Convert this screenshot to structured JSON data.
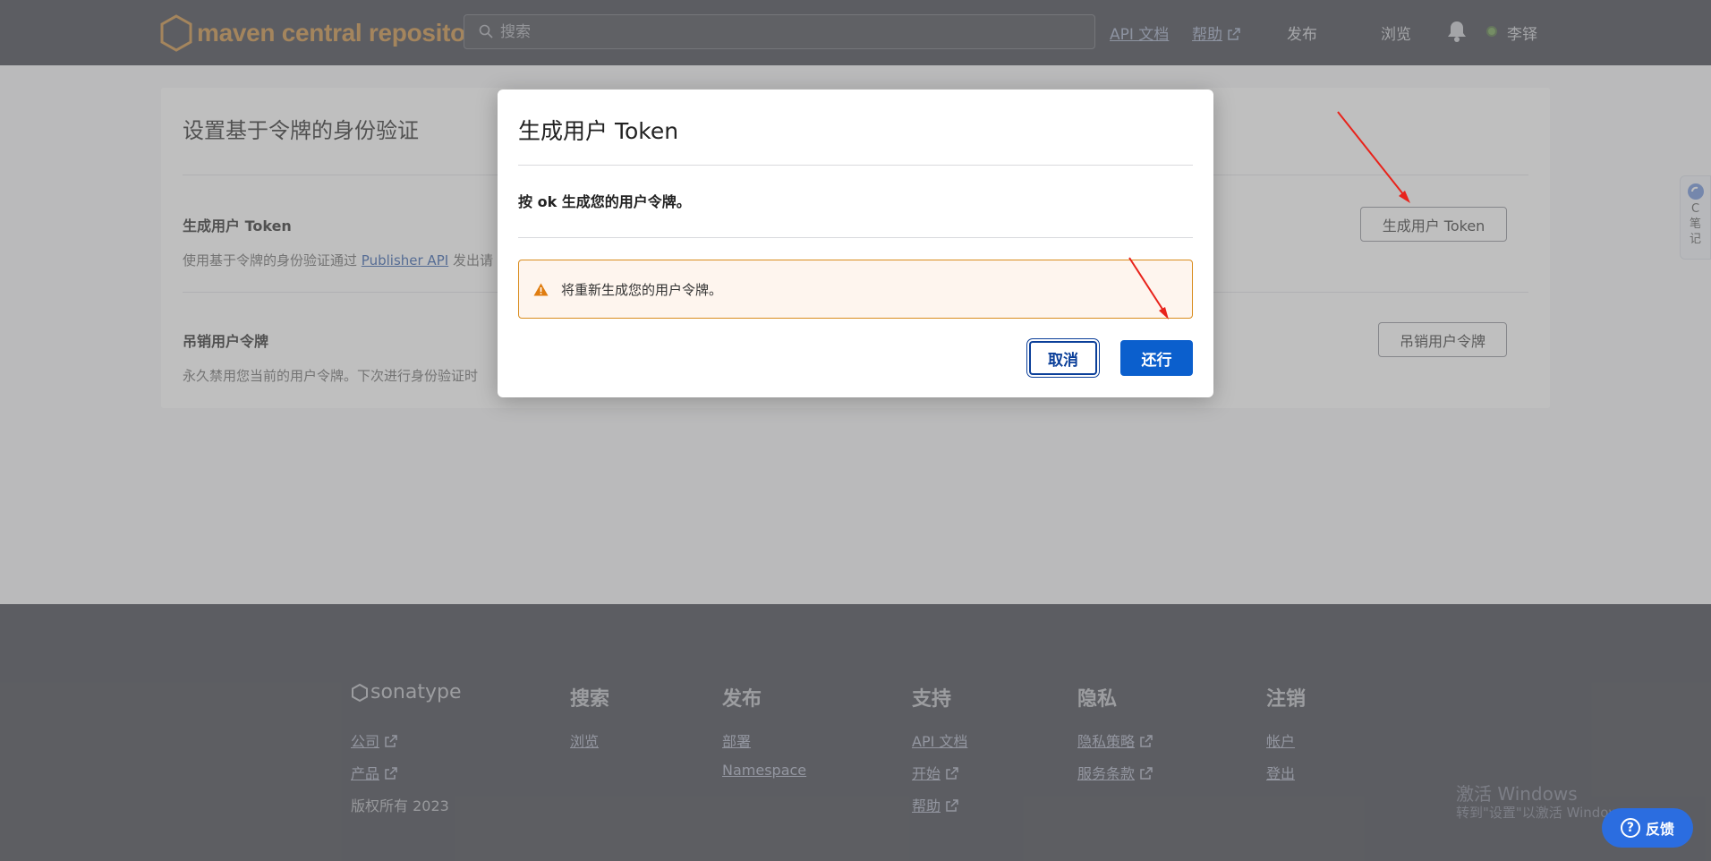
{
  "header": {
    "logo_text": "maven central repository",
    "search_placeholder": "搜索",
    "nav": {
      "api_docs": "API 文档",
      "help": "帮助",
      "publish": "发布",
      "browse": "浏览"
    },
    "user_name": "李铎"
  },
  "page": {
    "title": "设置基于令牌的身份验证",
    "generate": {
      "title": "生成用户 Token",
      "desc_prefix": "使用基于令牌的身份验证通过",
      "desc_link": "Publisher API",
      "desc_suffix": "发出请",
      "button": "生成用户 Token"
    },
    "revoke": {
      "title": "吊销用户令牌",
      "desc": "永久禁用您当前的用户令牌。下次进行身份验证时",
      "button": "吊销用户令牌"
    }
  },
  "modal": {
    "title": "生成用户 Token",
    "body": "按 ok 生成您的用户令牌。",
    "alert": "将重新生成您的用户令牌。",
    "cancel_label": "取消",
    "confirm_label": "还行"
  },
  "side_widget": {
    "lines": [
      "C",
      "笔",
      "记"
    ]
  },
  "footer": {
    "brand": "sonatype",
    "brand_links": [
      "公司",
      "产品"
    ],
    "copyright": "版权所有 2023",
    "columns": [
      {
        "heading": "搜索",
        "links": [
          "浏览"
        ]
      },
      {
        "heading": "发布",
        "links": [
          "部署",
          "Namespace"
        ]
      },
      {
        "heading": "支持",
        "links": [
          "API 文档",
          "开始",
          "帮助"
        ]
      },
      {
        "heading": "隐私",
        "links": [
          "隐私策略",
          "服务条款"
        ]
      },
      {
        "heading": "注销",
        "links": [
          "帐户",
          "登出"
        ]
      }
    ]
  },
  "windows": {
    "line1": "激活 Windows",
    "line2": "转到\"设置\"以激活 Windows。"
  },
  "feedback_label": "反馈",
  "colors": {
    "header_bg": "#393b44",
    "logo": "#c98a3b",
    "primary_button": "#0b5fcd",
    "alert_border": "#d98c1d",
    "alert_bg": "#fef5ee",
    "arrow": "#e8231b"
  }
}
